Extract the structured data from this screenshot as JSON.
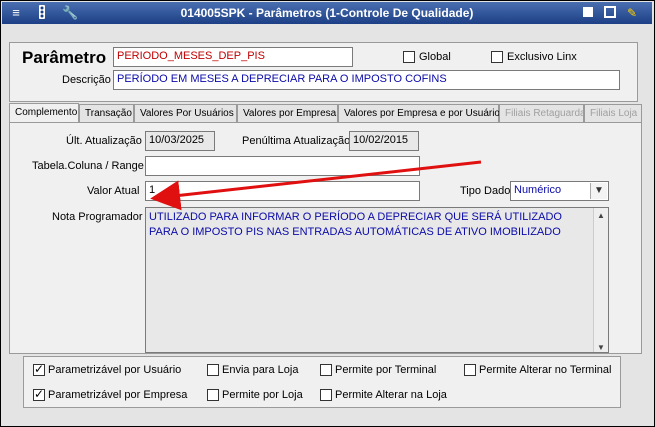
{
  "window": {
    "title": "014005SPK - Parâmetros (1-Controle De Qualidade)",
    "icons": [
      "menu-icon",
      "traffic-light-icon",
      "wrench-icon"
    ],
    "controls": [
      "stop-icon",
      "window-icon",
      "pencil-icon"
    ]
  },
  "header": {
    "parametro_label": "Parâmetro",
    "parametro_value": "PERIODO_MESES_DEP_PIS",
    "global_label": "Global",
    "exclusivo_label": "Exclusivo Linx",
    "descricao_label": "Descrição",
    "descricao_value": "PERÍODO EM MESES A DEPRECIAR PARA O IMPOSTO COFINS"
  },
  "tabs": [
    {
      "label": "Complemento",
      "active": true
    },
    {
      "label": "Transação"
    },
    {
      "label": "Valores Por Usuários"
    },
    {
      "label": "Valores por Empresa"
    },
    {
      "label": "Valores por Empresa e por Usuário"
    },
    {
      "label": "Filiais Retaguarda",
      "disabled": true
    },
    {
      "label": "Filiais Loja",
      "disabled": true
    }
  ],
  "complemento": {
    "ult_atualizacao_label": "Últ. Atualização",
    "ult_atualizacao_value": "10/03/2025",
    "penultima_label": "Penúltima Atualização",
    "penultima_value": "10/02/2015",
    "tabela_label": "Tabela.Coluna / Range",
    "tabela_value": "",
    "valor_atual_label": "Valor Atual",
    "valor_atual_value": "1",
    "tipo_dado_label": "Tipo Dado",
    "tipo_dado_value": "Numérico",
    "nota_label": "Nota Programador",
    "nota_value": "UTILIZADO PARA INFORMAR O PERÍODO A DEPRECIAR QUE SERÁ UTILIZADO PARA O IMPOSTO PIS NAS ENTRADAS AUTOMÁTICAS DE ATIVO IMOBILIZADO"
  },
  "checkboxes": {
    "param_usuario": "Parametrizável por Usuário",
    "envia_loja": "Envia para Loja",
    "permite_terminal": "Permite por Terminal",
    "permite_alterar_terminal": "Permite Alterar no Terminal",
    "param_empresa": "Parametrizável por Empresa",
    "permite_loja": "Permite por Loja",
    "permite_alterar_loja": "Permite Alterar na Loja"
  },
  "annotation": {
    "arrow_color": "#e01010"
  }
}
